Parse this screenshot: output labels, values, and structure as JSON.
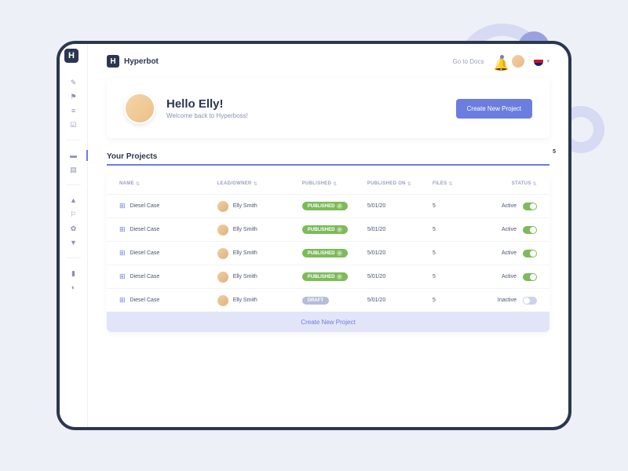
{
  "brand": {
    "name": "Hyperbot",
    "initial": "H"
  },
  "topbar": {
    "docs": "Go to Docs"
  },
  "hero": {
    "title": "Hello Elly!",
    "subtitle": "Welcome back to Hyperboss!",
    "cta": "Create New Project"
  },
  "section": {
    "title": "Your Projects",
    "count": "5"
  },
  "columns": {
    "name": "NAME",
    "lead": "LEAD/OWNER",
    "published": "PUBLISHED",
    "published_on": "PUBLISHED ON",
    "files": "FILES",
    "status": "STATUS"
  },
  "status_labels": {
    "active": "Active",
    "inactive": "Inactive"
  },
  "badge_labels": {
    "published": "PUBLISHED",
    "draft": "DRAFT"
  },
  "rows": [
    {
      "name": "Diesel Case",
      "owner": "Elly Smith",
      "badge": "published",
      "date": "5/01/20",
      "files": "5",
      "status": "active"
    },
    {
      "name": "Diesel Case",
      "owner": "Elly Smith",
      "badge": "published",
      "date": "5/01/20",
      "files": "5",
      "status": "active"
    },
    {
      "name": "Diesel Case",
      "owner": "Elly Smith",
      "badge": "published",
      "date": "5/01/20",
      "files": "5",
      "status": "active"
    },
    {
      "name": "Diesel Case",
      "owner": "Elly Smith",
      "badge": "published",
      "date": "5/01/20",
      "files": "5",
      "status": "active"
    },
    {
      "name": "Diesel Case",
      "owner": "Elly Smith",
      "badge": "draft",
      "date": "5/01/20",
      "files": "5",
      "status": "inactive"
    }
  ],
  "footer": {
    "cta": "Create New Project"
  }
}
